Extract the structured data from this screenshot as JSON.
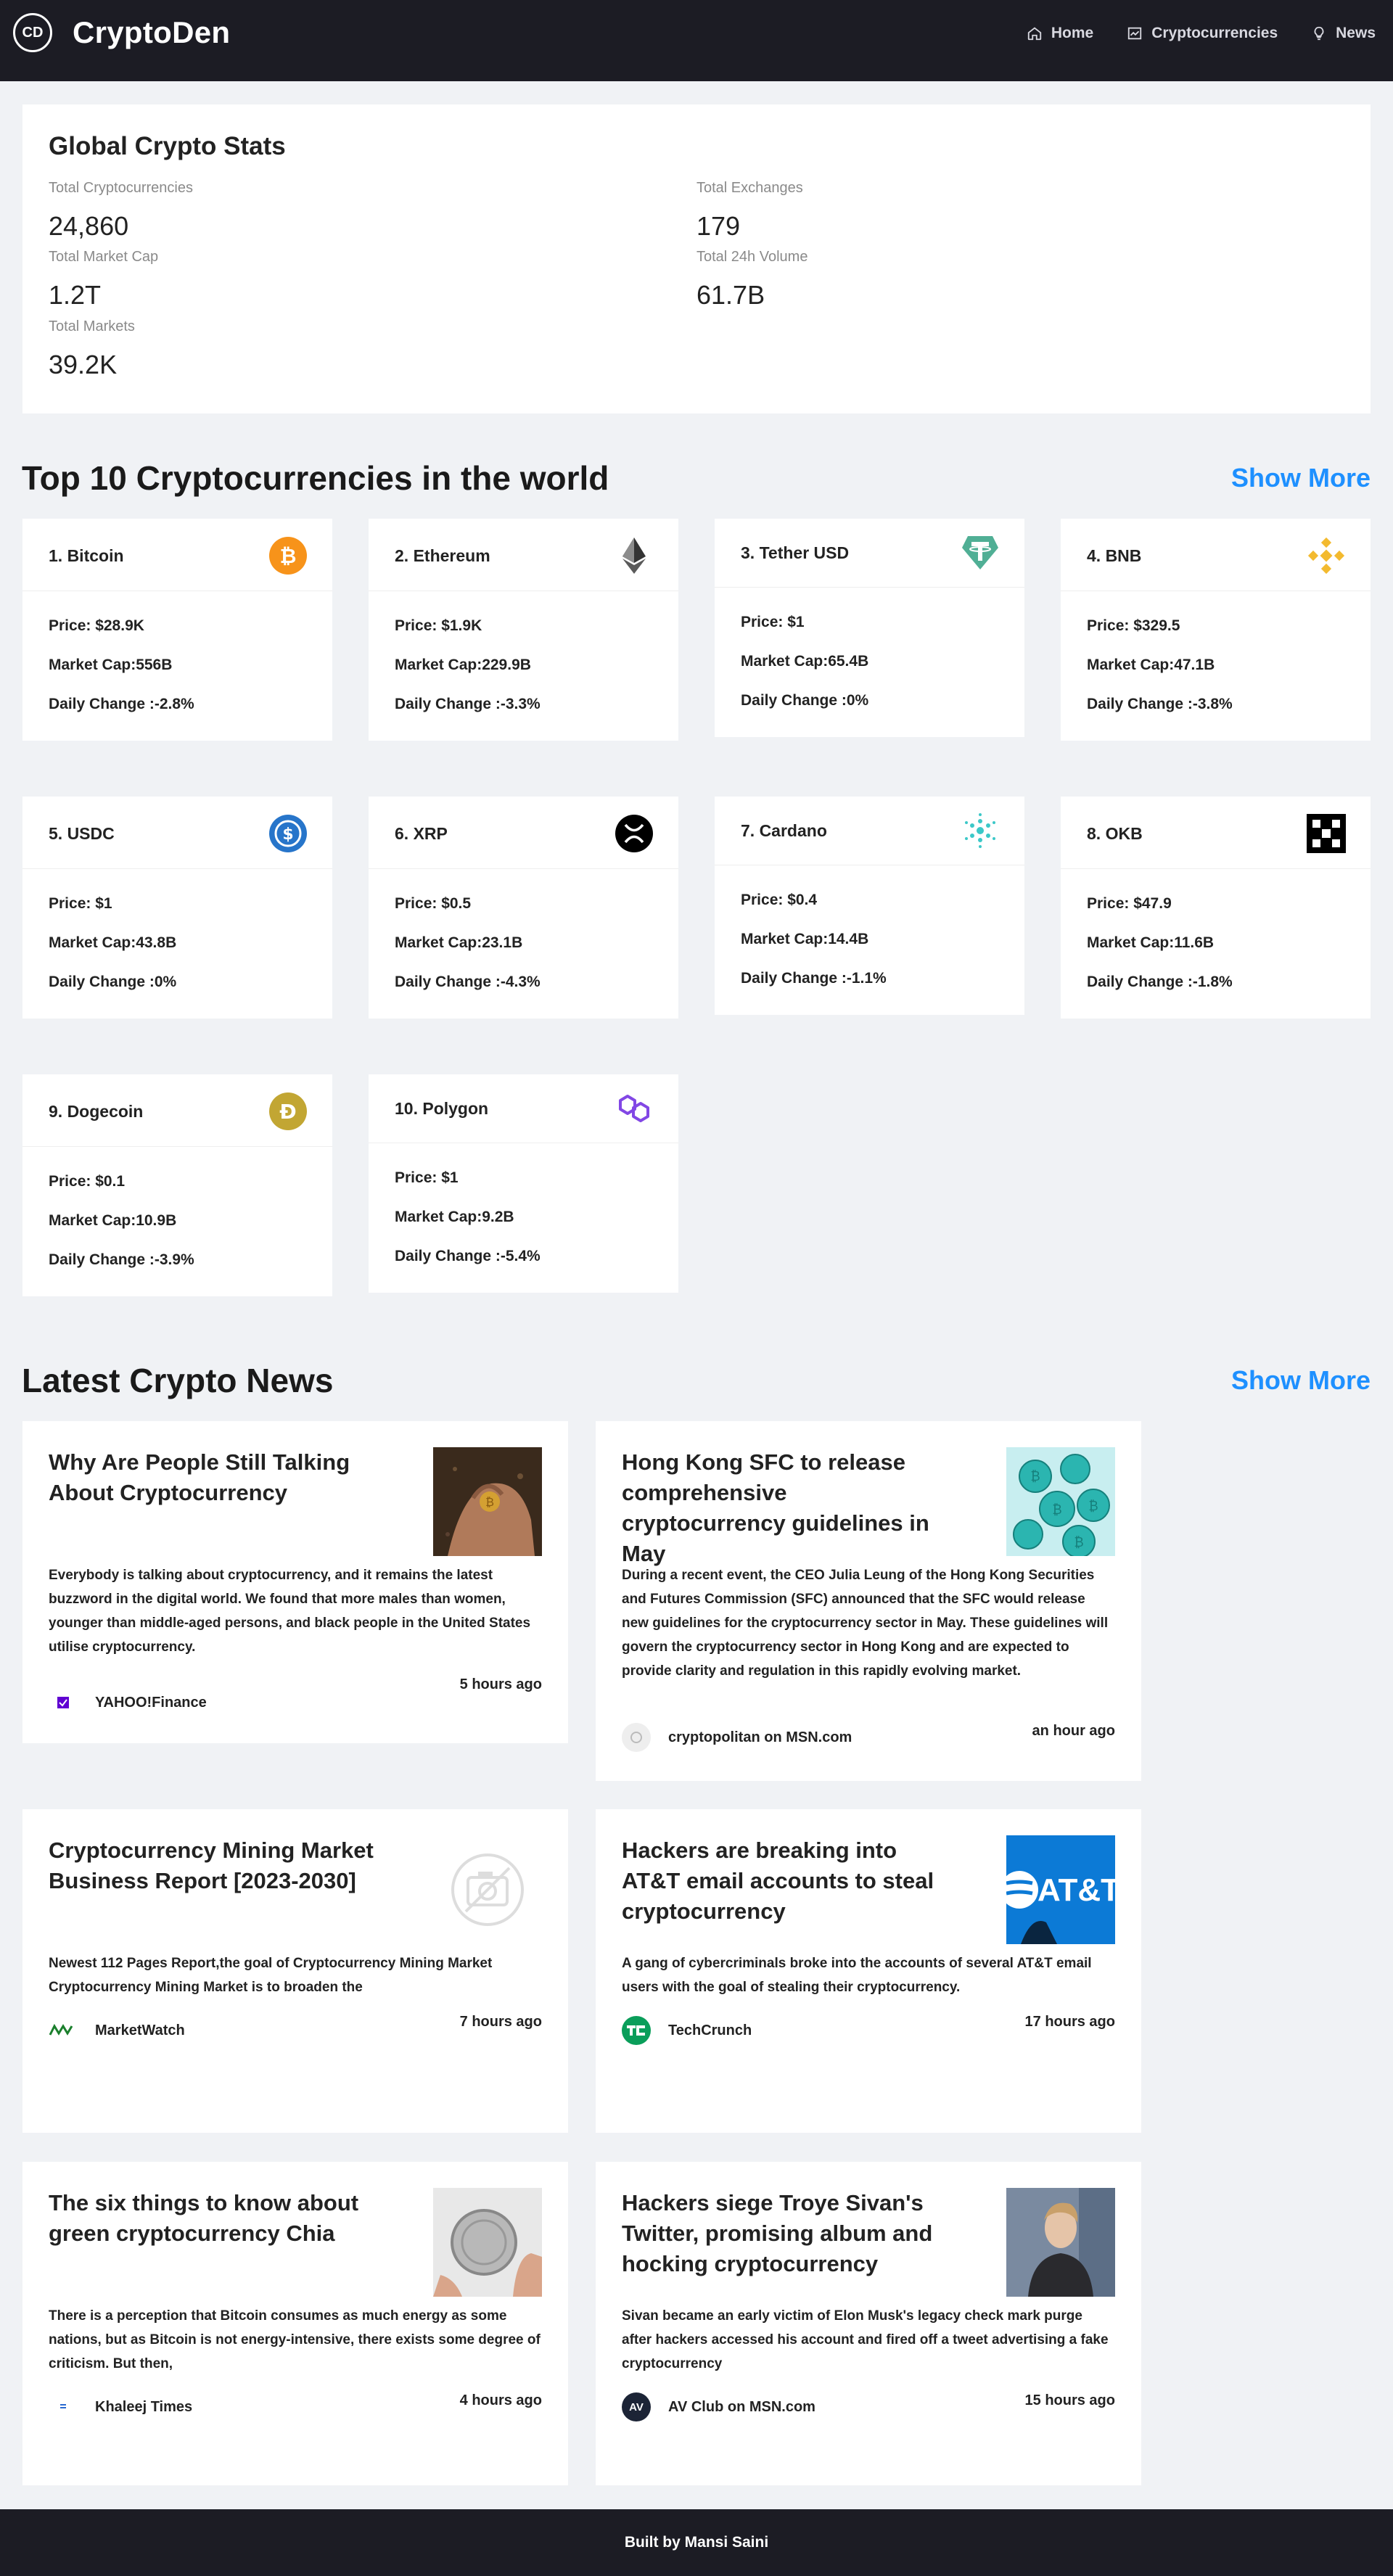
{
  "header": {
    "brand": "CryptoDen",
    "logo_text": "CD",
    "nav": [
      {
        "label": "Home",
        "icon": "home-icon"
      },
      {
        "label": "Cryptocurrencies",
        "icon": "chart-icon"
      },
      {
        "label": "News",
        "icon": "bulb-icon"
      }
    ]
  },
  "stats": {
    "title": "Global Crypto Stats",
    "items": [
      {
        "label": "Total Cryptocurrencies",
        "value": "24,860"
      },
      {
        "label": "Total Exchanges",
        "value": "179"
      },
      {
        "label": "Total Market Cap",
        "value": "1.2T"
      },
      {
        "label": "Total 24h Volume",
        "value": "61.7B"
      },
      {
        "label": "Total Markets",
        "value": "39.2K"
      }
    ]
  },
  "coins_section": {
    "title": "Top 10 Cryptocurrencies in the world",
    "show_more": "Show More"
  },
  "coins": [
    {
      "name": "1. Bitcoin",
      "price": "Price: $28.9K",
      "cap": "Market Cap:556B",
      "change": "Daily Change :-2.8%",
      "icon": "bitcoin-icon",
      "color": "#f7931a"
    },
    {
      "name": "2. Ethereum",
      "price": "Price: $1.9K",
      "cap": "Market Cap:229.9B",
      "change": "Daily Change :-3.3%",
      "icon": "ethereum-icon",
      "color": "#343434"
    },
    {
      "name": "3. Tether USD",
      "price": "Price: $1",
      "cap": "Market Cap:65.4B",
      "change": "Daily Change :0%",
      "icon": "tether-icon",
      "color": "#50af95"
    },
    {
      "name": "4. BNB",
      "price": "Price: $329.5",
      "cap": "Market Cap:47.1B",
      "change": "Daily Change :-3.8%",
      "icon": "bnb-icon",
      "color": "#f3ba2f"
    },
    {
      "name": "5. USDC",
      "price": "Price: $1",
      "cap": "Market Cap:43.8B",
      "change": "Daily Change :0%",
      "icon": "usdc-icon",
      "color": "#2775ca"
    },
    {
      "name": "6. XRP",
      "price": "Price: $0.5",
      "cap": "Market Cap:23.1B",
      "change": "Daily Change :-4.3%",
      "icon": "xrp-icon",
      "color": "#000000"
    },
    {
      "name": "7. Cardano",
      "price": "Price: $0.4",
      "cap": "Market Cap:14.4B",
      "change": "Daily Change :-1.1%",
      "icon": "cardano-icon",
      "color": "#3cc8c8"
    },
    {
      "name": "8. OKB",
      "price": "Price: $47.9",
      "cap": "Market Cap:11.6B",
      "change": "Daily Change :-1.8%",
      "icon": "okb-icon",
      "color": "#000000"
    },
    {
      "name": "9. Dogecoin",
      "price": "Price: $0.1",
      "cap": "Market Cap:10.9B",
      "change": "Daily Change :-3.9%",
      "icon": "dogecoin-icon",
      "color": "#c2a633"
    },
    {
      "name": "10. Polygon",
      "price": "Price: $1",
      "cap": "Market Cap:9.2B",
      "change": "Daily Change :-5.4%",
      "icon": "polygon-icon",
      "color": "#8247e5"
    }
  ],
  "news_section": {
    "title": "Latest Crypto News",
    "show_more": "Show More"
  },
  "news": [
    {
      "title": "Why Are People Still Talking About Cryptocurrency",
      "desc": "Everybody is talking about cryptocurrency, and it remains the latest buzzword in the digital world. We found that more males than women, younger than middle-aged persons, and black people in the United States utilise cryptocurrency.",
      "provider": "YAHOO!Finance",
      "time": "5 hours ago",
      "image": "hands-coin-image",
      "provider_icon": "yahoo-icon"
    },
    {
      "title": "Hong Kong SFC to release comprehensive cryptocurrency guidelines in May",
      "desc": "During a recent event, the CEO Julia Leung of the Hong Kong Securities and Futures Commission (SFC) announced that the SFC would release new guidelines for the cryptocurrency sector in May. These guidelines will govern the cryptocurrency sector in Hong Kong and are expected to provide clarity and regulation in this rapidly evolving market.",
      "provider": "cryptopolitan on MSN.com",
      "time": "an hour ago",
      "image": "teal-coins-image",
      "provider_icon": "cryptopolitan-icon"
    },
    {
      "title": "Cryptocurrency Mining Market Business Report [2023-2030]",
      "desc": "Newest 112 Pages Report,the goal of Cryptocurrency Mining Market Cryptocurrency Mining Market is to broaden the",
      "provider": "MarketWatch",
      "time": "7 hours ago",
      "image": "camera-placeholder-icon",
      "provider_icon": "marketwatch-icon"
    },
    {
      "title": "Hackers are breaking into AT&T email accounts to steal cryptocurrency",
      "desc": "A gang of cybercriminals broke into the accounts of several AT&T email users with the goal of stealing their cryptocurrency.",
      "provider": "TechCrunch",
      "time": "17 hours ago",
      "image": "att-logo-image",
      "provider_icon": "techcrunch-icon",
      "image_text": "AT&T"
    },
    {
      "title": "The six things to know about green cryptocurrency Chia",
      "desc": "There is a perception that Bitcoin consumes as much energy as some nations, but as Bitcoin is not energy-intensive, there exists some degree of criticism. But then,",
      "provider": "Khaleej Times",
      "time": "4 hours ago",
      "image": "coin-in-hand-image",
      "provider_icon": "khaleej-icon"
    },
    {
      "title": "Hackers siege Troye Sivan's Twitter, promising album and hocking cryptocurrency",
      "desc": "Sivan became an early victim of Elon Musk's legacy check mark purge after hackers accessed his account and fired off a tweet advertising a fake cryptocurrency",
      "provider": "AV Club on MSN.com",
      "time": "15 hours ago",
      "image": "person-photo-image",
      "provider_icon": "avclub-icon",
      "provider_icon_text": "AV"
    }
  ],
  "footer": {
    "text": "Built by Mansi Saini"
  }
}
